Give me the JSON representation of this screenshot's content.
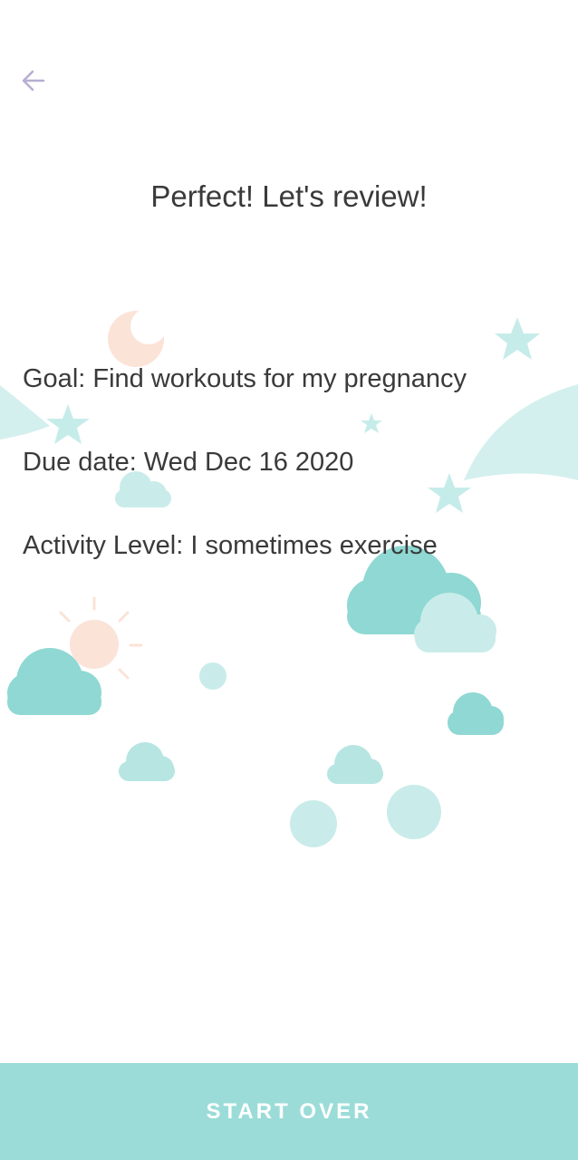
{
  "header": {
    "back_icon": "arrow-left-icon",
    "title": "Perfect! Let's review!"
  },
  "review": {
    "goal": "Goal: Find workouts for my pregnancy",
    "due_date": "Due date: Wed Dec 16 2020",
    "activity_level": "Activity Level: I sometimes exercise"
  },
  "footer": {
    "start_over_label": "START OVER"
  },
  "colors": {
    "accent": "#9bdcd8",
    "cloud": "#8fd8d3",
    "cloud_light": "#c9ecea",
    "peach": "#fbe3d7",
    "back_arrow": "#b7aed2"
  }
}
